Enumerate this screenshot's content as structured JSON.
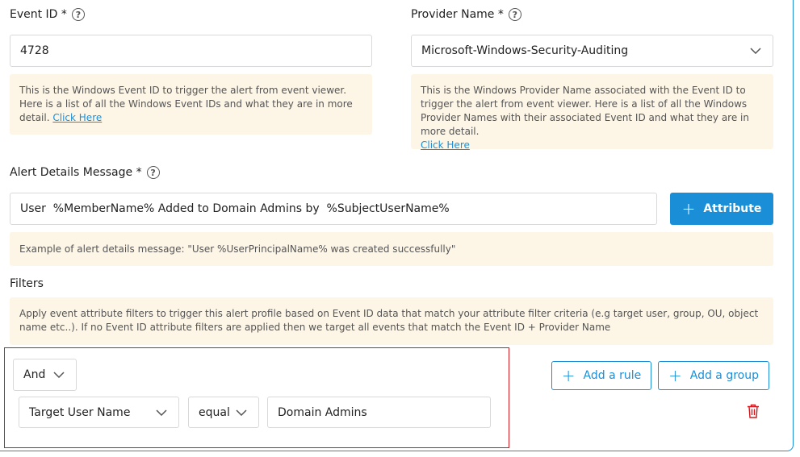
{
  "event_id": {
    "label": "Event ID *",
    "value": "4728",
    "note": "This is the Windows Event ID to trigger the alert from event viewer. Here is a list of all the Windows Event IDs and what they are in more detail.",
    "note_link": "Click Here"
  },
  "provider_name": {
    "label": "Provider Name *",
    "value": "Microsoft-Windows-Security-Auditing",
    "note": "This is the Windows Provider Name associated with the Event ID to trigger the alert from event viewer. Here is a list of all the Windows Provider Names with their associated Event ID and what they are in more detail.",
    "note_link": "Click Here"
  },
  "alert_message": {
    "label": "Alert Details Message *",
    "value": "User  %MemberName% Added to Domain Admins by  %SubjectUserName%",
    "attribute_button": "Attribute",
    "example": "Example of alert details message: \"User %UserPrincipalName% was created successfully\""
  },
  "filters": {
    "label": "Filters",
    "note": "Apply event attribute filters to trigger this alert profile based on Event ID data that match your attribute filter criteria (e.g target user, group, OU, object name etc..). If no Event ID attribute filters are applied then we target all events that match the Event ID + Provider Name",
    "combinator": "And",
    "add_rule": "Add a rule",
    "add_group": "Add a group",
    "rule": {
      "field": "Target User Name",
      "operator": "equal",
      "value": "Domain Admins"
    }
  },
  "icons": {
    "help": "question-circle-icon",
    "chevron": "chevron-down-icon",
    "plus": "plus-icon",
    "delete": "trash-icon"
  },
  "colors": {
    "accent": "#1a8fd8",
    "note_bg": "#fdf6e7",
    "highlight_border": "#d0181e",
    "delete": "#d0181e"
  }
}
